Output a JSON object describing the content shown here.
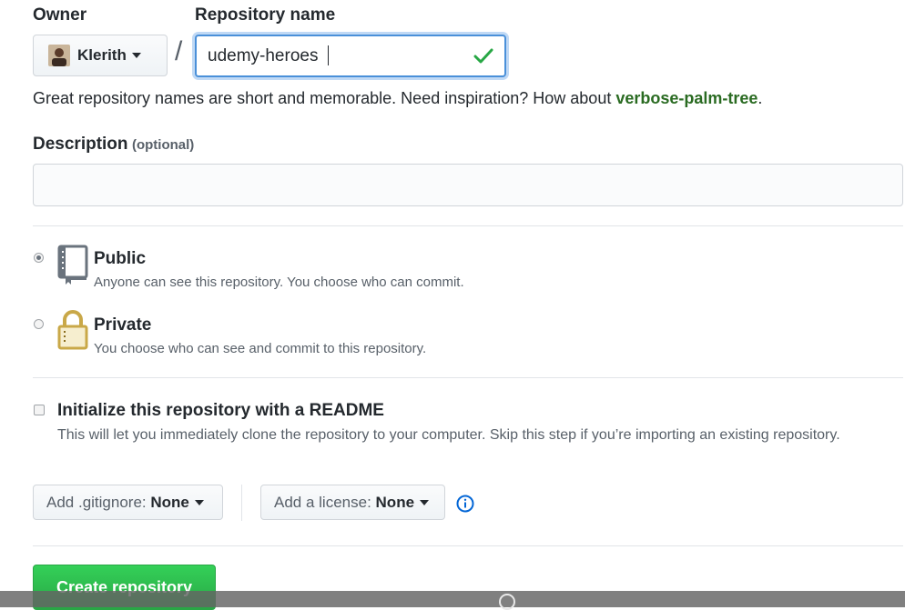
{
  "owner": {
    "label": "Owner",
    "value": "Klerith"
  },
  "repo": {
    "label": "Repository name",
    "value": "udemy-heroes"
  },
  "separator": "/",
  "hint": {
    "text": "Great repository names are short and memorable. Need inspiration? How about ",
    "suggestion": "verbose-palm-tree",
    "end": "."
  },
  "description": {
    "label": "Description",
    "optional": "(optional)",
    "value": ""
  },
  "visibility": [
    {
      "title": "Public",
      "desc": "Anyone can see this repository. You choose who can commit.",
      "selected": true
    },
    {
      "title": "Private",
      "desc": "You choose who can see and commit to this repository.",
      "selected": false
    }
  ],
  "readme": {
    "title": "Initialize this repository with a README",
    "desc": "This will let you immediately clone the repository to your computer. Skip this step if you’re importing an existing repository.",
    "checked": false
  },
  "gitignore": {
    "label": "Add .gitignore:",
    "value": "None"
  },
  "license": {
    "label": "Add a license:",
    "value": "None"
  },
  "submit": {
    "label": "Create repository"
  },
  "colors": {
    "accent": "#28a745",
    "suggestion": "#2a6b22",
    "info": "#0366d6"
  }
}
